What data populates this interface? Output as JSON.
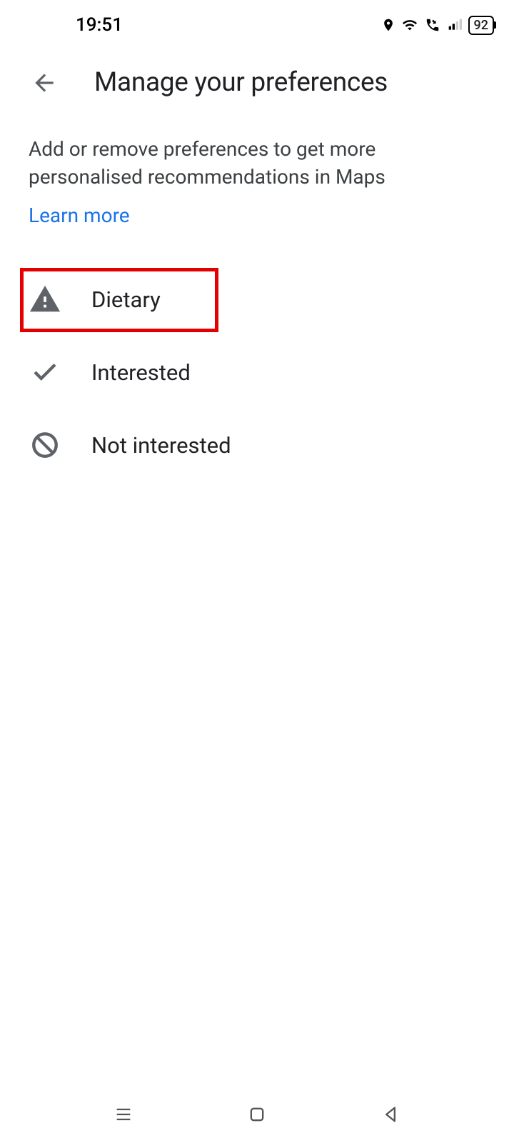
{
  "status": {
    "time": "19:51",
    "battery": "92"
  },
  "header": {
    "title": "Manage your preferences"
  },
  "content": {
    "description": "Add or remove preferences to get more personalised recommendations in Maps",
    "learn_more": "Learn more"
  },
  "preferences": {
    "items": [
      {
        "label": "Dietary",
        "icon": "warning"
      },
      {
        "label": "Interested",
        "icon": "check"
      },
      {
        "label": "Not interested",
        "icon": "block"
      }
    ]
  }
}
